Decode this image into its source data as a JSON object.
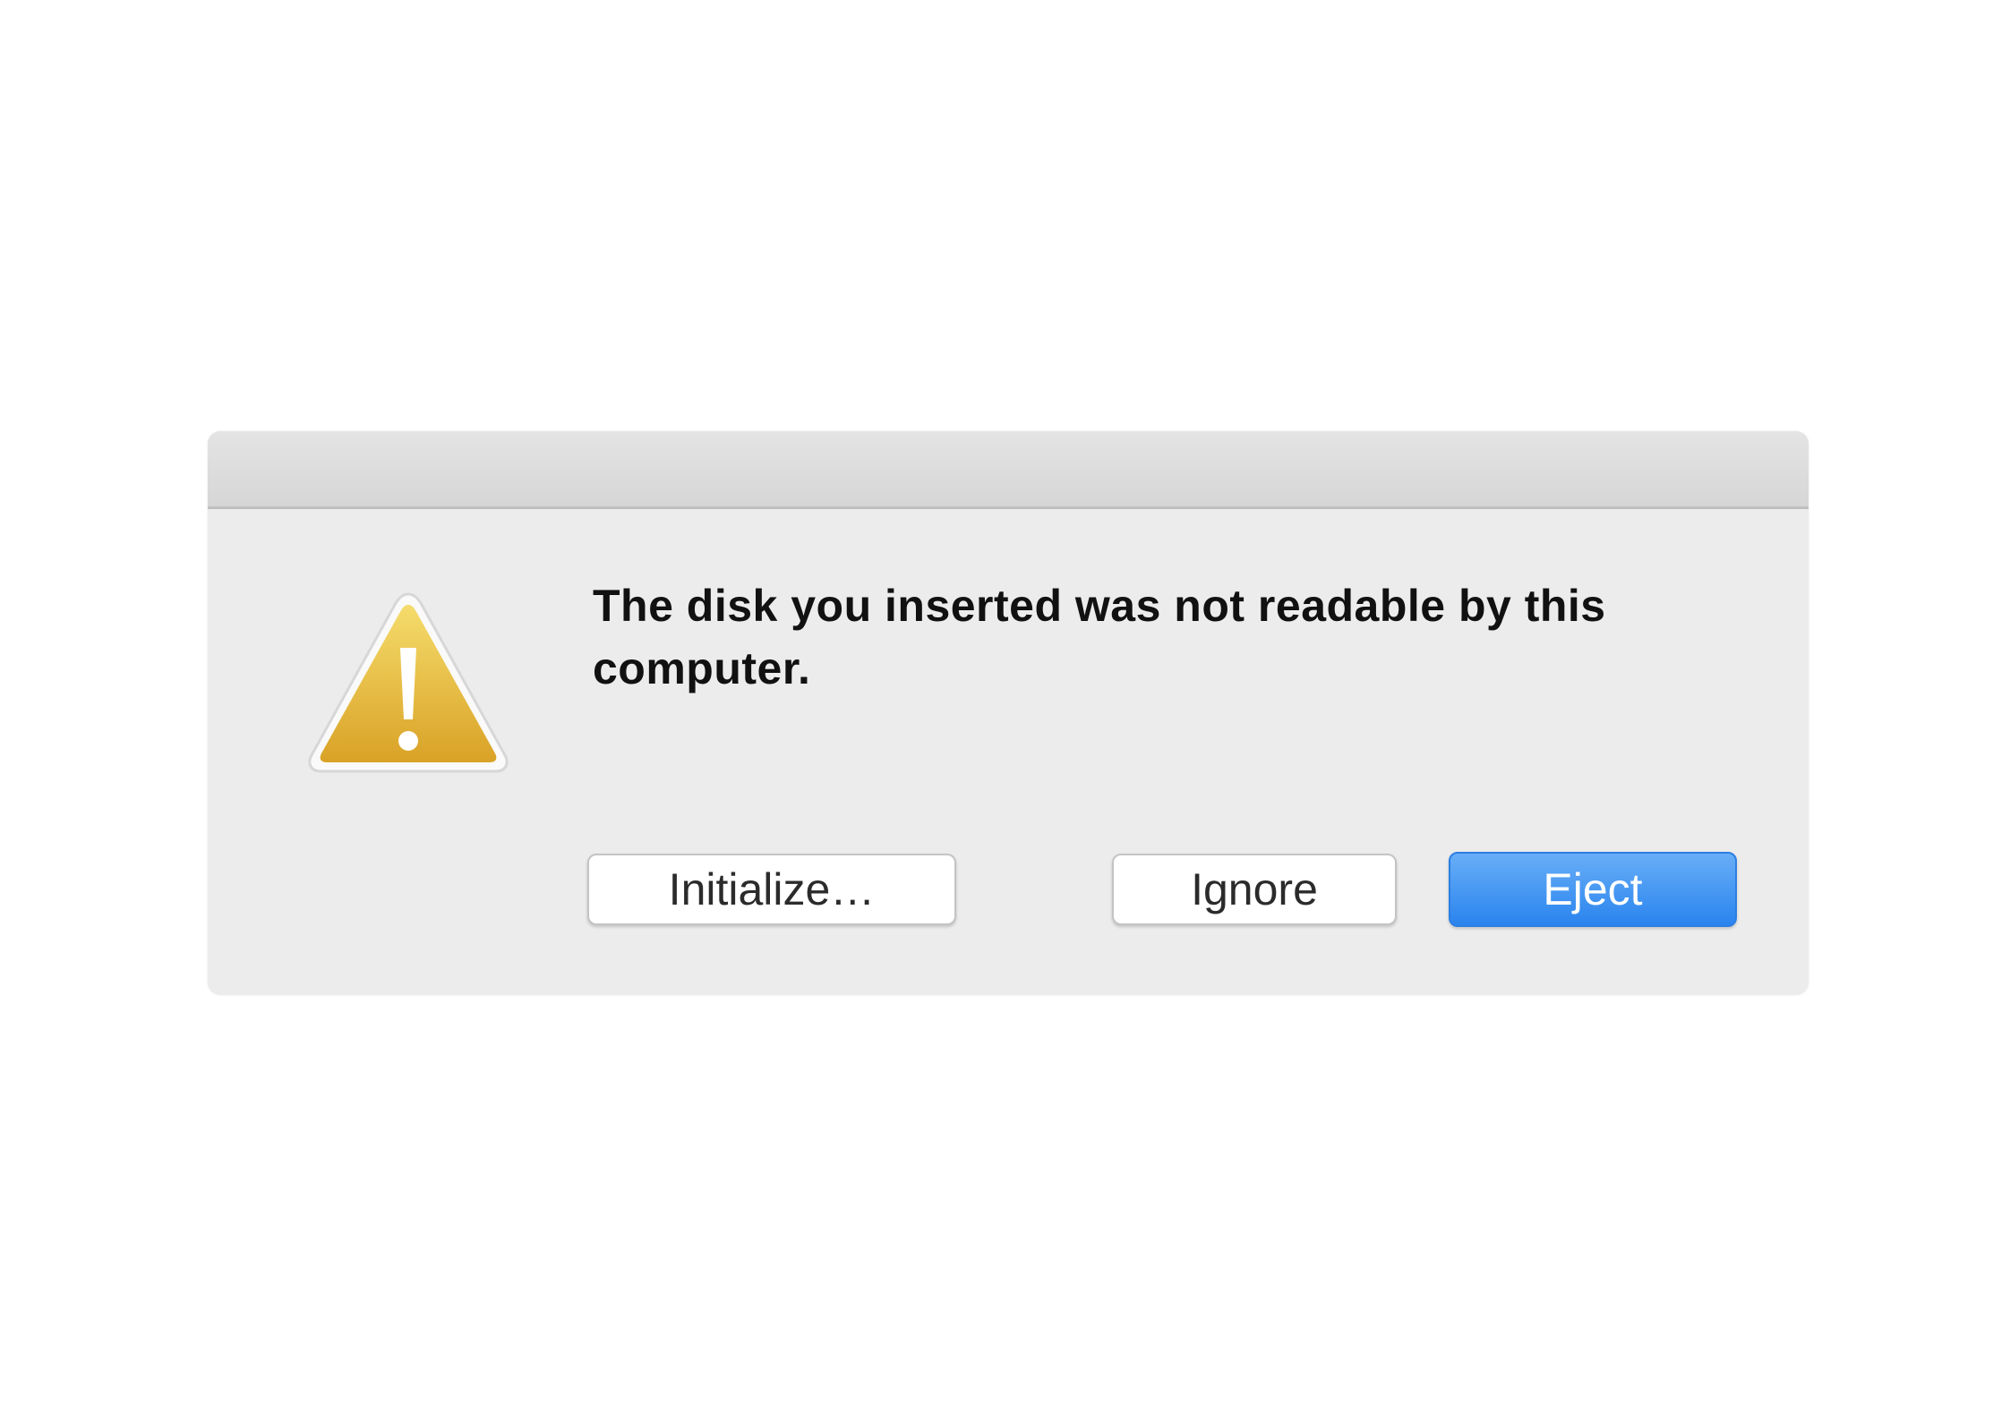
{
  "dialog": {
    "message": "The disk you inserted was not readable by this computer.",
    "icon": "warning-triangle-icon",
    "buttons": {
      "initialize": "Initialize…",
      "ignore": "Ignore",
      "eject": "Eject"
    }
  },
  "colors": {
    "dialog_background": "#ececec",
    "default_button": "#2a84ee",
    "warning_icon": "#e2b23c"
  }
}
